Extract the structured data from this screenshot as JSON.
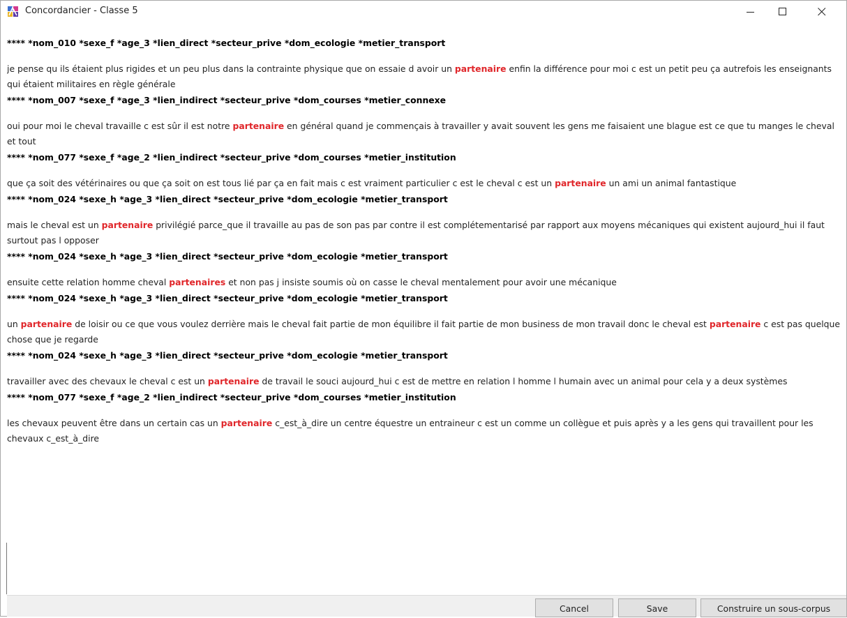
{
  "window": {
    "title": "Concordancier - Classe 5",
    "controls": {
      "minimize": "minimize",
      "maximize": "maximize",
      "close": "close"
    }
  },
  "keyword_color": "#e0262a",
  "entries": [
    {
      "meta": "**** *nom_010 *sexe_f *age_3 *lien_direct *secteur_prive *dom_ecologie *metier_transport",
      "segments": [
        {
          "t": "je pense qu ils étaient plus rigides et un peu plus dans la contrainte physique que on essaie d avoir un ",
          "k": false
        },
        {
          "t": "partenaire",
          "k": true
        },
        {
          "t": " enfin la différence pour moi c est un petit peu ça autrefois les enseignants qui étaient militaires en règle générale",
          "k": false
        }
      ]
    },
    {
      "meta": "**** *nom_007 *sexe_f *age_3 *lien_indirect *secteur_prive *dom_courses *metier_connexe",
      "segments": [
        {
          "t": "oui pour moi le cheval travaille c est sûr il est notre ",
          "k": false
        },
        {
          "t": "partenaire",
          "k": true
        },
        {
          "t": " en général quand je commençais à travailler y avait souvent les gens me faisaient une blague est ce que tu manges le cheval et tout",
          "k": false
        }
      ]
    },
    {
      "meta": "**** *nom_077 *sexe_f *age_2 *lien_indirect *secteur_prive *dom_courses *metier_institution",
      "segments": [
        {
          "t": "que ça soit des vétérinaires ou que ça soit on est tous lié par ça en fait mais c est vraiment particulier c est le cheval c est un ",
          "k": false
        },
        {
          "t": "partenaire",
          "k": true
        },
        {
          "t": " un ami un animal fantastique",
          "k": false
        }
      ]
    },
    {
      "meta": "**** *nom_024 *sexe_h *age_3 *lien_direct *secteur_prive *dom_ecologie *metier_transport",
      "segments": [
        {
          "t": "mais le cheval est un ",
          "k": false
        },
        {
          "t": "partenaire",
          "k": true
        },
        {
          "t": " privilégié parce_que il travaille au pas de son pas par contre il est complétementarisé par rapport aux moyens mécaniques qui existent aujourd_hui il faut surtout pas l opposer",
          "k": false
        }
      ]
    },
    {
      "meta": "**** *nom_024 *sexe_h *age_3 *lien_direct *secteur_prive *dom_ecologie *metier_transport",
      "segments": [
        {
          "t": "ensuite cette relation homme cheval ",
          "k": false
        },
        {
          "t": "partenaires",
          "k": true
        },
        {
          "t": " et non pas j insiste soumis où on casse le cheval mentalement pour avoir une mécanique",
          "k": false
        }
      ]
    },
    {
      "meta": "**** *nom_024 *sexe_h *age_3 *lien_direct *secteur_prive *dom_ecologie *metier_transport",
      "segments": [
        {
          "t": "un ",
          "k": false
        },
        {
          "t": "partenaire",
          "k": true
        },
        {
          "t": " de loisir ou ce que vous voulez derrière mais le cheval fait partie de mon équilibre il fait partie de mon business de mon travail donc le cheval est ",
          "k": false
        },
        {
          "t": "partenaire",
          "k": true
        },
        {
          "t": " c est pas quelque chose que je regarde",
          "k": false
        }
      ]
    },
    {
      "meta": "**** *nom_024 *sexe_h *age_3 *lien_direct *secteur_prive *dom_ecologie *metier_transport",
      "segments": [
        {
          "t": "travailler avec des chevaux le cheval c est un ",
          "k": false
        },
        {
          "t": "partenaire",
          "k": true
        },
        {
          "t": " de travail le souci aujourd_hui c est de mettre en relation l homme l humain avec un animal pour cela y a deux systèmes",
          "k": false
        }
      ]
    },
    {
      "meta": "**** *nom_077 *sexe_f *age_2 *lien_indirect *secteur_prive *dom_courses *metier_institution",
      "segments": [
        {
          "t": "les chevaux peuvent être dans un certain cas un ",
          "k": false
        },
        {
          "t": "partenaire",
          "k": true
        },
        {
          "t": " c_est_à_dire un centre équestre un entraineur c est un comme un collègue et puis après y a les gens qui travaillent pour les chevaux c_est_à_dire",
          "k": false
        }
      ]
    }
  ],
  "buttons": {
    "cancel": "Cancel",
    "save": "Save",
    "build": "Construire un sous-corpus"
  }
}
